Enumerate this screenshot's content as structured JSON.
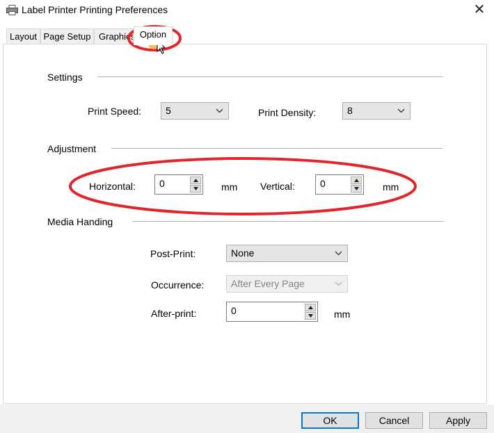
{
  "window": {
    "title": "Label Printer Printing Preferences",
    "close_glyph": "✕"
  },
  "tabs": [
    {
      "label": "Layout"
    },
    {
      "label": "Page Setup"
    },
    {
      "label": "Graphics"
    },
    {
      "label": "Option",
      "active": true
    }
  ],
  "settings": {
    "heading": "Settings",
    "print_speed_label": "Print Speed:",
    "print_speed_value": "5",
    "print_density_label": "Print Density:",
    "print_density_value": "8"
  },
  "adjustment": {
    "heading": "Adjustment",
    "horizontal_label": "Horizontal:",
    "horizontal_value": "0",
    "horizontal_unit": "mm",
    "vertical_label": "Vertical:",
    "vertical_value": "0",
    "vertical_unit": "mm"
  },
  "media": {
    "heading": "Media Handing",
    "post_print_label": "Post-Print:",
    "post_print_value": "None",
    "occurrence_label": "Occurrence:",
    "occurrence_value": "After Every Page",
    "after_print_label": "After-print:",
    "after_print_value": "0",
    "after_print_unit": "mm"
  },
  "buttons": {
    "ok": "OK",
    "cancel": "Cancel",
    "apply": "Apply"
  },
  "annotation": {
    "color": "#e0262b"
  }
}
